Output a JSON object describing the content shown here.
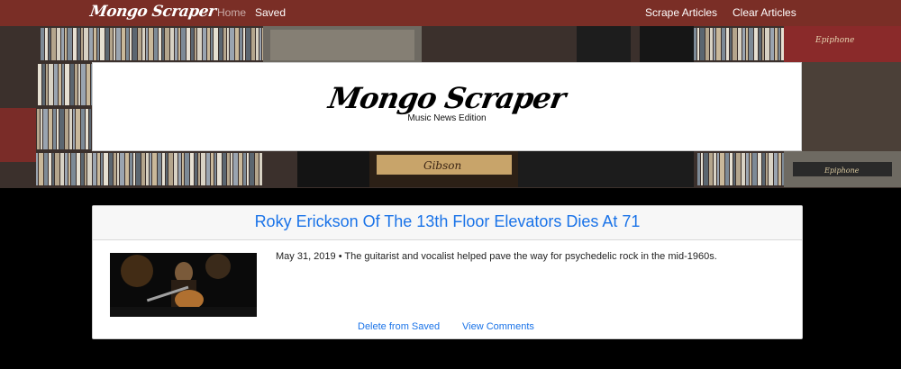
{
  "navbar": {
    "brand": "Mongo Scraper",
    "home": "Home",
    "saved": "Saved",
    "scrape": "Scrape Articles",
    "clear": "Clear Articles"
  },
  "header": {
    "title": "Mongo Scraper",
    "subtitle": "Music News Edition"
  },
  "article": {
    "title": "Roky Erickson Of The 13th Floor Elevators Dies At 71",
    "summary": "May 31, 2019 • The guitarist and vocalist helped pave the way for psychedelic rock in the mid-1960s.",
    "delete_label": "Delete from Saved",
    "comments_label": "View Comments"
  },
  "colors": {
    "navbar": "#7a2e26",
    "link": "#1a73e8"
  },
  "hero_amp_labels": [
    "Gibson",
    "Epiphone",
    "Epiphone"
  ]
}
